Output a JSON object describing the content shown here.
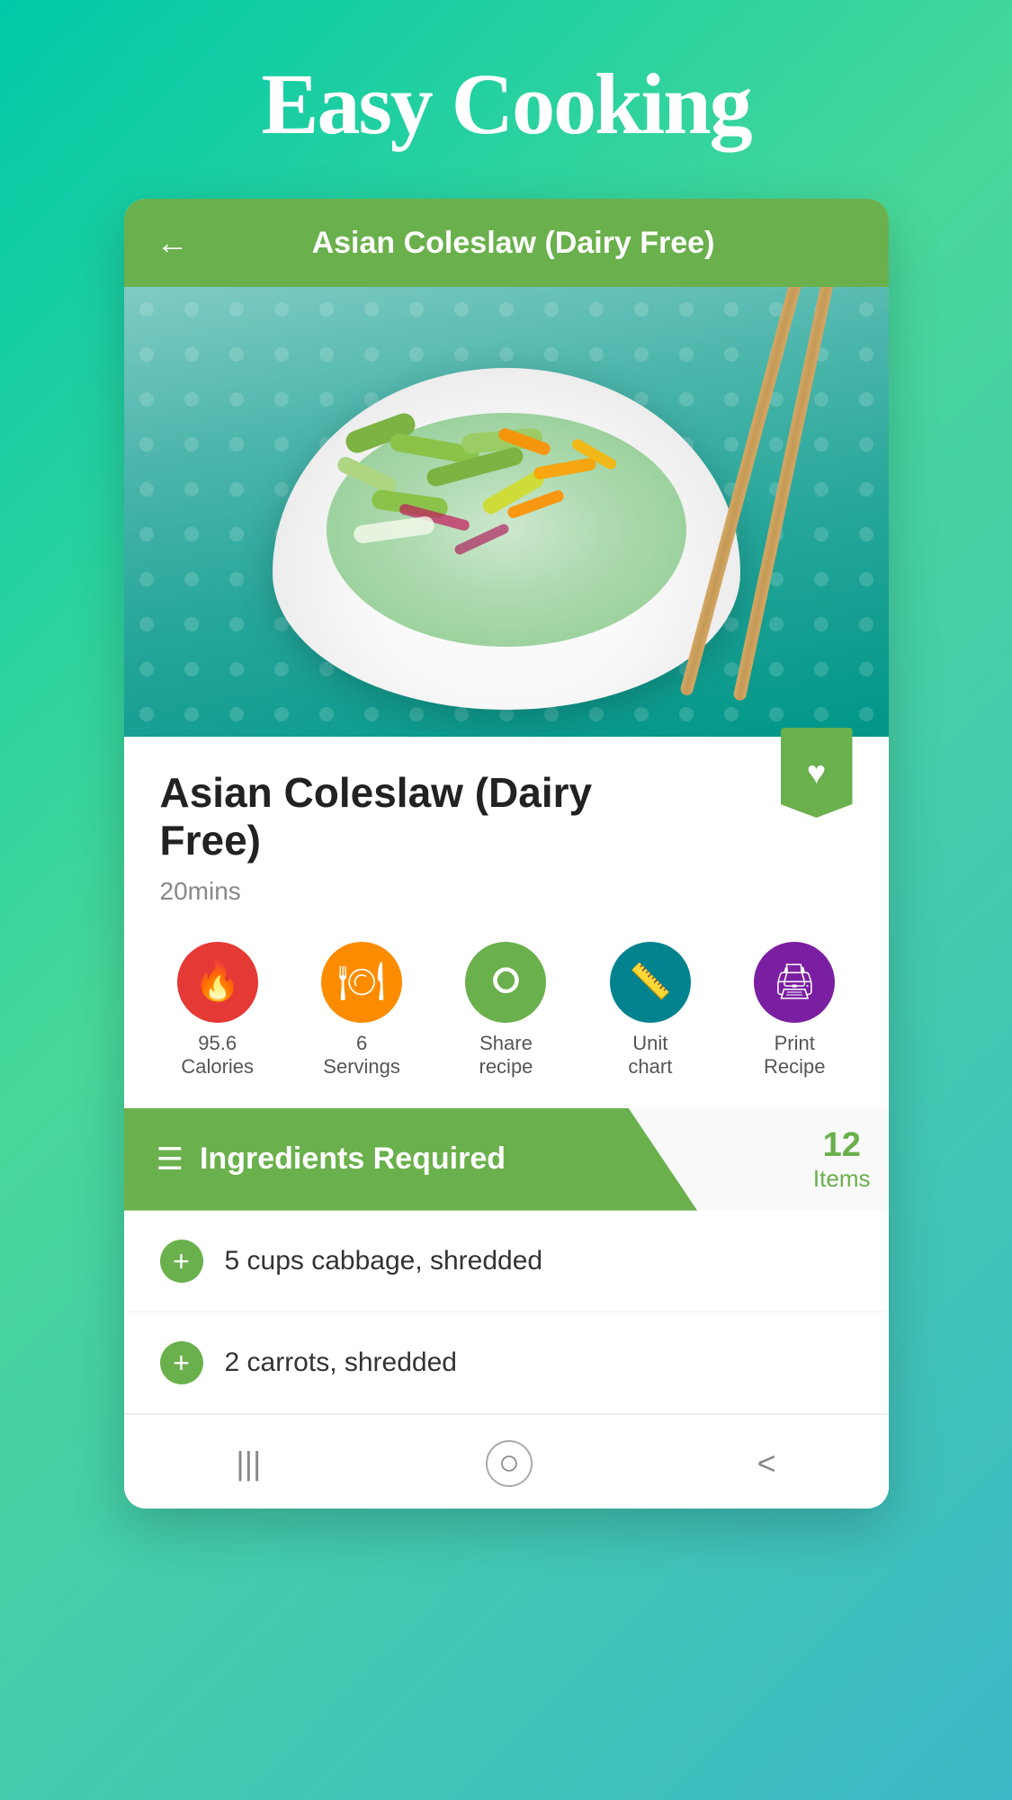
{
  "app": {
    "title": "Easy Cooking"
  },
  "header": {
    "back_label": "←",
    "recipe_name": "Asian Coleslaw (Dairy Free)"
  },
  "recipe": {
    "title": "Asian Coleslaw (Dairy Free)",
    "time": "20mins",
    "bookmark_accessible": "Add to favorites"
  },
  "actions": [
    {
      "id": "calories",
      "label_line1": "95.6",
      "label_line2": "Calories",
      "color_class": "circle-red",
      "icon": "♥"
    },
    {
      "id": "servings",
      "label_line1": "6",
      "label_line2": "Servings",
      "color_class": "circle-orange",
      "icon": "⬤"
    },
    {
      "id": "share",
      "label_line1": "Share",
      "label_line2": "recipe",
      "color_class": "circle-green",
      "icon": "⬆"
    },
    {
      "id": "unit-chart",
      "label_line1": "Unit",
      "label_line2": "chart",
      "color_class": "circle-teal",
      "icon": "▤"
    },
    {
      "id": "print",
      "label_line1": "Print",
      "label_line2": "Recipe",
      "color_class": "circle-purple",
      "icon": "⊟"
    }
  ],
  "ingredients": {
    "header": "Ingredients Required",
    "items_count": "12",
    "items_label": "Items",
    "list": [
      {
        "text": "5 cups cabbage, shredded"
      },
      {
        "text": "2 carrots, shredded"
      }
    ]
  },
  "bottom_nav": {
    "menu_icon": "|||",
    "home_icon": "○",
    "back_icon": "<"
  }
}
